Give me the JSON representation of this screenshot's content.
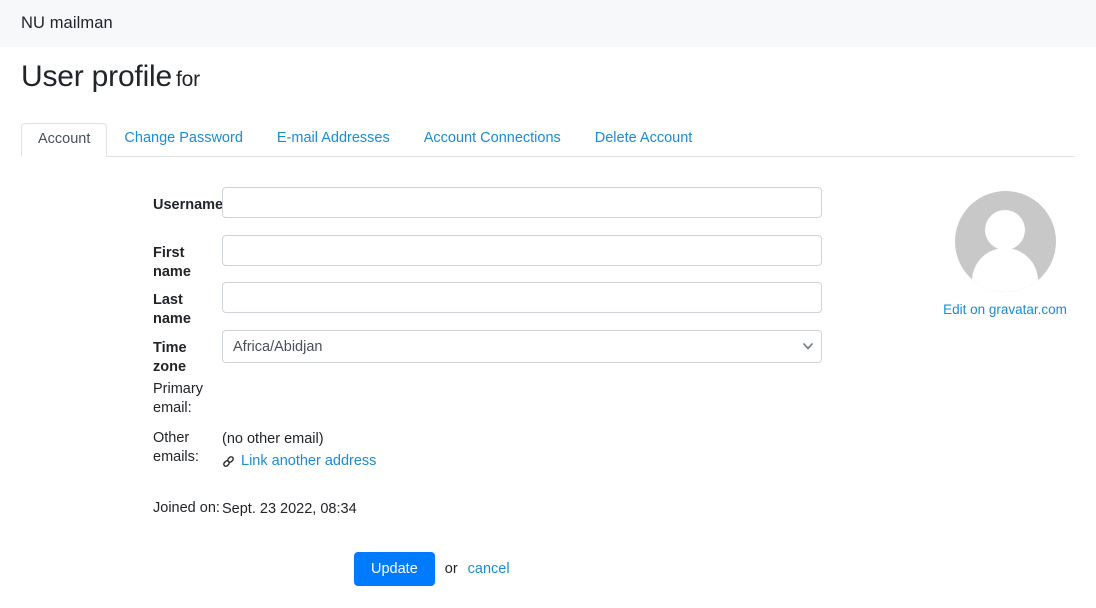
{
  "brand": {
    "name": "NU mailman"
  },
  "page": {
    "title": "User profile",
    "title_suffix": "for",
    "subject_redacted": ""
  },
  "tabs": [
    {
      "label": "Account",
      "active": true
    },
    {
      "label": "Change Password",
      "active": false
    },
    {
      "label": "E-mail Addresses",
      "active": false
    },
    {
      "label": "Account Connections",
      "active": false
    },
    {
      "label": "Delete Account",
      "active": false
    }
  ],
  "form": {
    "username": {
      "label": "Username",
      "value": "",
      "placeholder": ""
    },
    "first_name": {
      "label": "First name",
      "value": "",
      "placeholder": ""
    },
    "last_name": {
      "label": "Last name",
      "value": "",
      "placeholder": ""
    },
    "time_zone": {
      "label": "Time zone",
      "value": "Africa/Abidjan"
    },
    "primary_email": {
      "label": "Primary email:",
      "value": ""
    },
    "other_emails": {
      "label": "Other emails:",
      "value": "(no other email)",
      "link_label": "Link another address",
      "link_icon": "chain-link-icon"
    },
    "joined_on": {
      "label": "Joined on:",
      "value": "Sept. 23 2022, 08:34"
    }
  },
  "avatar": {
    "icon": "user-avatar-placeholder-icon",
    "edit_link": "Edit on gravatar.com"
  },
  "actions": {
    "update_label": "Update",
    "or_label": "or",
    "cancel_label": "cancel"
  },
  "colors": {
    "accent": "#007bff",
    "link": "#1a8cd8",
    "topbar_bg": "#f7f8fa",
    "border": "#ced4da",
    "tab_border": "#dee2e6",
    "avatar_gray": "#c8c8c8",
    "text": "#212529"
  }
}
